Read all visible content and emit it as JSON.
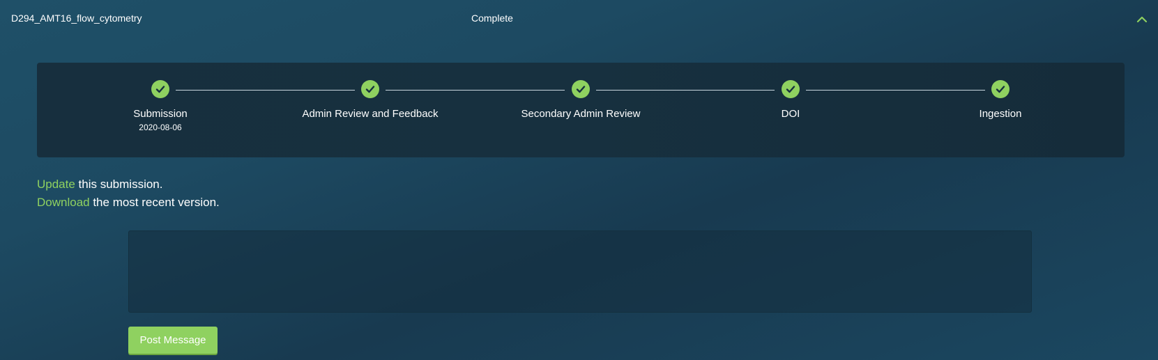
{
  "header": {
    "dataset_name": "D294_AMT16_flow_cytometry",
    "status": "Complete",
    "collapse_icon": "chevron-up-icon",
    "accent_color": "#8fd160"
  },
  "progress": {
    "steps": [
      {
        "label": "Submission",
        "date": "2020-08-06",
        "complete": true
      },
      {
        "label": "Admin Review and Feedback",
        "complete": true
      },
      {
        "label": "Secondary Admin Review",
        "complete": true
      },
      {
        "label": "DOI",
        "complete": true
      },
      {
        "label": "Ingestion",
        "complete": true
      }
    ],
    "check_icon": "checkmark-icon"
  },
  "actions": {
    "update_link": "Update",
    "update_text": " this submission.",
    "download_link": "Download",
    "download_text": " the most recent version."
  },
  "message": {
    "value": "",
    "placeholder": ""
  },
  "buttons": {
    "post_message": "Post Message"
  }
}
